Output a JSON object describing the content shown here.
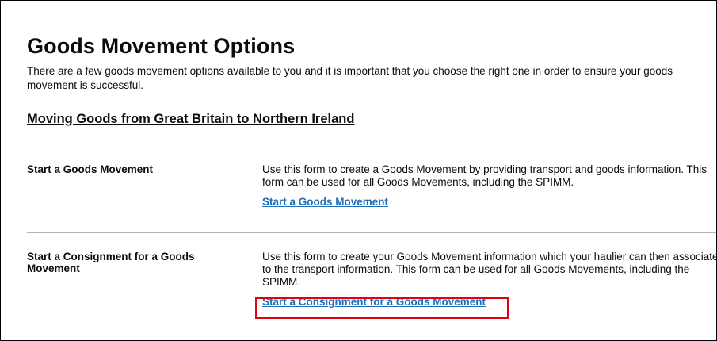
{
  "page": {
    "title": "Goods Movement Options",
    "intro": "There are a few goods movement options available to you and it is important that you choose the right one in order to ensure your goods movement is successful.",
    "section_heading": "Moving Goods from Great Britain to Northern Ireland"
  },
  "options": [
    {
      "label": "Start a Goods Movement",
      "description": "Use this form to create a Goods Movement by providing transport and goods information. This form can be used for all Goods Movements, including the SPIMM.",
      "link": "Start a Goods Movement"
    },
    {
      "label": "Start a Consignment for a Goods Movement",
      "description": "Use this form to create your Goods Movement information which your haulier can then associate to the transport information. This form can be used for all Goods Movements, including the SPIMM.",
      "link": "Start a Consignment for a Goods Movement"
    }
  ],
  "colors": {
    "link": "#1d70b8",
    "highlight": "#e3000f",
    "divider": "#b1b4b6",
    "text": "#0b0c0c"
  }
}
